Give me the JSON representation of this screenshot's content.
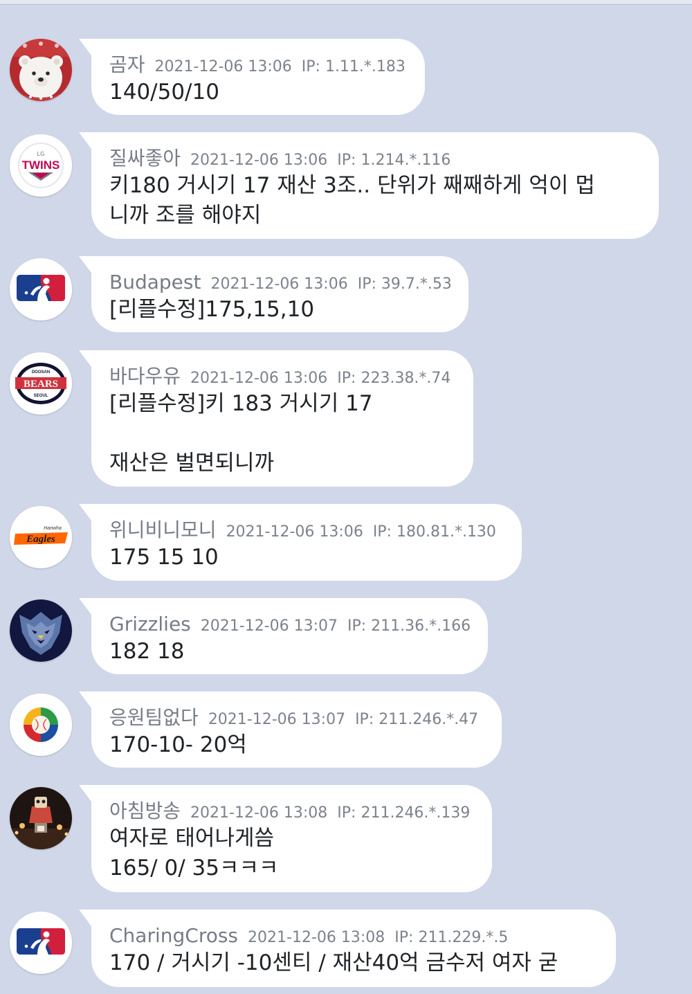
{
  "comments": [
    {
      "nick": "곰자",
      "time": "2021-12-06 13:06",
      "ip": "IP: 1.11.*.183",
      "text": "140/50/10",
      "avatar": "polar-bear-icon"
    },
    {
      "nick": "질싸좋아",
      "time": "2021-12-06 13:06",
      "ip": "IP: 1.214.*.116",
      "text": "키180 거시기 17 재산 3조.. 단위가 째째하게 억이 멉\n니까 조를 해야지",
      "avatar": "lg-twins-logo-icon"
    },
    {
      "nick": "Budapest",
      "time": "2021-12-06 13:06",
      "ip": "IP: 39.7.*.53",
      "text": "[리플수정]175,15,10",
      "avatar": "mlb-logo-icon"
    },
    {
      "nick": "바다우유",
      "time": "2021-12-06 13:06",
      "ip": "IP: 223.38.*.74",
      "text": "[리플수정]키 183 거시기 17\n\n재산은 벌면되니까",
      "avatar": "doosan-bears-logo-icon"
    },
    {
      "nick": "위니비니모니",
      "time": "2021-12-06 13:06",
      "ip": "IP: 180.81.*.130",
      "text": "175 15 10",
      "avatar": "hanwha-eagles-logo-icon"
    },
    {
      "nick": "Grizzlies",
      "time": "2021-12-06 13:07",
      "ip": "IP: 211.36.*.166",
      "text": "182 18",
      "avatar": "grizzlies-logo-icon"
    },
    {
      "nick": "응원팀없다",
      "time": "2021-12-06 13:07",
      "ip": "IP: 211.246.*.47",
      "text": "170-10- 20억",
      "avatar": "world-baseball-classic-logo-icon"
    },
    {
      "nick": "아침방송",
      "time": "2021-12-06 13:08",
      "ip": "IP: 211.246.*.139",
      "text": "여자로 태어나게씀\n165/ 0/ 35ㅋㅋㅋ",
      "avatar": "photo-avatar-icon"
    },
    {
      "nick": "CharingCross",
      "time": "2021-12-06 13:08",
      "ip": "IP: 211.229.*.5",
      "text": "170 / 거시기 -10센티 / 재산40억 금수저 여자 굳",
      "avatar": "mlb-logo-icon"
    }
  ],
  "logo_text": {
    "lg": "LG",
    "twins": "TWINS",
    "doosan": "DOOSAN",
    "bears": "BEARS",
    "seoul": "SEOUL",
    "hanwha": "Hanwha",
    "eagles": "Eagles"
  },
  "colors": {
    "background": "#cfd7e8",
    "bubble": "#ffffff",
    "nickname": "#767c86",
    "message": "#1f2226",
    "mlb_blue": "#1b3f8f",
    "mlb_red": "#d21f3c",
    "lg_red": "#c30452",
    "bears_navy": "#131230",
    "bears_red": "#d0323d",
    "eagles_orange": "#ff6600",
    "grizzlies_navy": "#12173f",
    "grizzlies_blue": "#5d76a9"
  }
}
